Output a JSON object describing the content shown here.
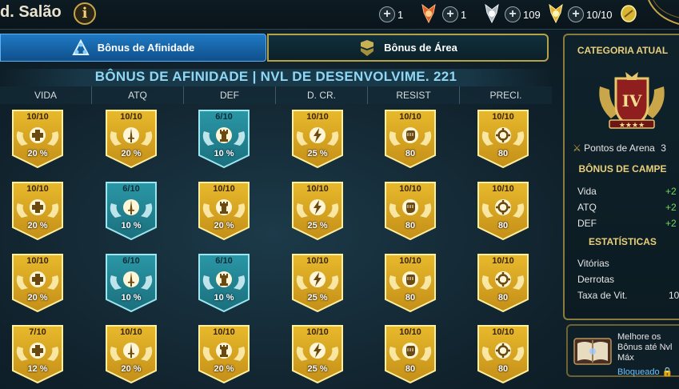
{
  "header": {
    "title": "d. Salão",
    "info_icon": "info-icon",
    "resources": [
      {
        "value": "1",
        "icon": "orange-medal-icon"
      },
      {
        "value": "1",
        "icon": "silver-medal-icon"
      },
      {
        "value": "109",
        "icon": "gold-medal-icon"
      },
      {
        "value": "10/10",
        "icon": "gold-token-icon"
      }
    ]
  },
  "tabs": [
    {
      "label": "Bônus de Afinidade",
      "icon": "affinity-icon",
      "active": true
    },
    {
      "label": "Bônus de Área",
      "icon": "area-icon",
      "active": false
    }
  ],
  "board": {
    "title": "BÔNUS DE AFINIDADE | NVL DE DESENVOLVIME. 221",
    "columns": [
      "VIDA",
      "ATQ",
      "DEF",
      "D. CR.",
      "RESIST",
      "PRECI."
    ],
    "column_icons": [
      "cross-icon",
      "sword-icon",
      "tower-icon",
      "lightning-icon",
      "fist-icon",
      "crosshair-icon"
    ],
    "rows": [
      [
        {
          "level": "10/10",
          "value": "20 %",
          "tier": "gold"
        },
        {
          "level": "10/10",
          "value": "20 %",
          "tier": "gold"
        },
        {
          "level": "6/10",
          "value": "10 %",
          "tier": "blue"
        },
        {
          "level": "10/10",
          "value": "25 %",
          "tier": "gold"
        },
        {
          "level": "10/10",
          "value": "80",
          "tier": "gold"
        },
        {
          "level": "10/10",
          "value": "80",
          "tier": "gold"
        }
      ],
      [
        {
          "level": "10/10",
          "value": "20 %",
          "tier": "gold"
        },
        {
          "level": "6/10",
          "value": "10 %",
          "tier": "blue"
        },
        {
          "level": "10/10",
          "value": "20 %",
          "tier": "gold"
        },
        {
          "level": "10/10",
          "value": "25 %",
          "tier": "gold"
        },
        {
          "level": "10/10",
          "value": "80",
          "tier": "gold"
        },
        {
          "level": "10/10",
          "value": "80",
          "tier": "gold"
        }
      ],
      [
        {
          "level": "10/10",
          "value": "20 %",
          "tier": "gold"
        },
        {
          "level": "6/10",
          "value": "10 %",
          "tier": "blue"
        },
        {
          "level": "6/10",
          "value": "10 %",
          "tier": "blue"
        },
        {
          "level": "10/10",
          "value": "25 %",
          "tier": "gold"
        },
        {
          "level": "10/10",
          "value": "80",
          "tier": "gold"
        },
        {
          "level": "10/10",
          "value": "80",
          "tier": "gold"
        }
      ],
      [
        {
          "level": "7/10",
          "value": "12 %",
          "tier": "gold"
        },
        {
          "level": "10/10",
          "value": "20 %",
          "tier": "gold"
        },
        {
          "level": "10/10",
          "value": "20 %",
          "tier": "gold"
        },
        {
          "level": "10/10",
          "value": "25 %",
          "tier": "gold"
        },
        {
          "level": "10/10",
          "value": "80",
          "tier": "gold"
        },
        {
          "level": "10/10",
          "value": "80",
          "tier": "gold"
        }
      ]
    ]
  },
  "side": {
    "category_title": "CATEGORIA ATUAL",
    "rank_numeral": "IV",
    "arena_points": "Pontos de Arena",
    "arena_points_value": "3",
    "champion_bonus_title": "BÔNUS DE CAMPE",
    "champion_bonus": [
      {
        "label": "Vida",
        "value": "+2"
      },
      {
        "label": "ATQ",
        "value": "+2"
      },
      {
        "label": "DEF",
        "value": "+2"
      }
    ],
    "stats_title": "ESTATÍSTICAS",
    "stats": [
      {
        "label": "Vitórias",
        "value": ""
      },
      {
        "label": "Derrotas",
        "value": ""
      },
      {
        "label": "Taxa de Vit.",
        "value": "10"
      }
    ],
    "footer": {
      "line1": "Melhore os",
      "line2": "Bônus até Nvl",
      "line3": "Máx",
      "status": "Bloqueado"
    }
  },
  "colors": {
    "gold_tier": "#e8b92c",
    "blue_tier": "#2a97a6",
    "accent": "#8fd8f5",
    "bonus_green": "#6fdc5a"
  }
}
